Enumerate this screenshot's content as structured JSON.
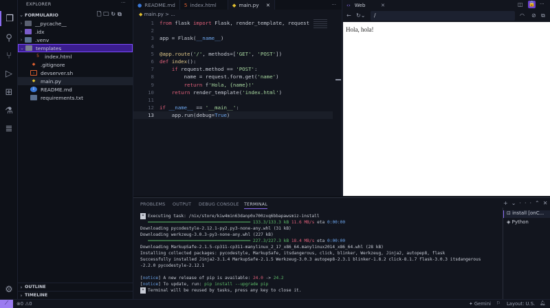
{
  "activity_bar": {
    "icons": [
      "files-icon",
      "search-icon",
      "source-control-icon",
      "run-debug-icon",
      "extensions-icon",
      "testing-icon",
      "list-icon"
    ],
    "settings": "gear-icon"
  },
  "sidebar": {
    "title": "EXPLORER",
    "project": "FORMULARIO",
    "items": [
      {
        "label": "__pycache__",
        "type": "folder",
        "expanded": false
      },
      {
        "label": ".idx",
        "type": "folder",
        "expanded": false
      },
      {
        "label": ".venv",
        "type": "folder",
        "expanded": false
      },
      {
        "label": "templates",
        "type": "folder",
        "expanded": true,
        "selected": true
      },
      {
        "label": "index.html",
        "type": "html"
      },
      {
        "label": ".gitignore",
        "type": "git"
      },
      {
        "label": "devserver.sh",
        "type": "shell"
      },
      {
        "label": "main.py",
        "type": "python",
        "active": true
      },
      {
        "label": "README.md",
        "type": "info"
      },
      {
        "label": "requirements.txt",
        "type": "text"
      }
    ],
    "outline": "OUTLINE",
    "timeline": "TIMELINE"
  },
  "editor": {
    "tabs": [
      {
        "label": "README.md"
      },
      {
        "label": "index.html"
      },
      {
        "label": "main.py",
        "active": true
      }
    ],
    "breadcrumb": "main.py > ...",
    "current_line": 13,
    "lines": [
      "from flask import Flask, render_template, request",
      "",
      "app = Flask(__name__)",
      "",
      "@app.route('/', methods=['GET', 'POST'])",
      "def index():",
      "    if request.method == 'POST':",
      "        name = request.form.get('name')",
      "        return f'Hola, {name}!'",
      "    return render_template('index.html')",
      "",
      "if __name__ == '__main__':",
      "    app.run(debug=True)"
    ]
  },
  "web": {
    "tab": "Web",
    "url": "/",
    "content": "Hola, hola!"
  },
  "panel": {
    "tabs": [
      "PROBLEMS",
      "OUTPUT",
      "DEBUG CONSOLE",
      "TERMINAL"
    ],
    "active_tab": "TERMINAL",
    "terminal": {
      "task": "Executing task: /nix/store/kiw4min63danp0x700zxq6bbapawsmiz-install",
      "p1": {
        "size": "133.3/133.3 kB",
        "speed": "11.6 MB/s",
        "eta_label": "eta",
        "eta": "0:00:00"
      },
      "l2": "Downloading pycodestyle-2.12.1-py2.py3-none-any.whl (31 kB)",
      "l3": "Downloading werkzeug-3.0.3-py3-none-any.whl (227 kB)",
      "p2": {
        "size": "227.3/227.3 kB",
        "speed": "18.4 MB/s",
        "eta_label": "eta",
        "eta": "0:00:00"
      },
      "l5": "Downloading MarkupSafe-2.1.5-cp311-cp311-manylinux_2_17_x86_64.manylinux2014_x86_64.whl (28 kB)",
      "l6": "Installing collected packages: pycodestyle, MarkupSafe, itsdangerous, click, blinker, Werkzeug, Jinja2, autopep8, flask",
      "l7": "Successfully installed Jinja2-3.1.4 MarkupSafe-2.1.5 Werkzeug-3.0.3 autopep8-2.3.1 blinker-1.8.2 click-8.1.7 flask-3.0.3 itsdangerous",
      "l8": "-2.2.0 pycodestyle-2.12.1",
      "n1": {
        "tag": "notice",
        "text": " A new release of pip is available: ",
        "old": "24.0",
        "arrow": " -> ",
        "new": "24.2"
      },
      "n2": {
        "tag": "notice",
        "text": " To update, run: ",
        "cmd": "pip install --upgrade pip"
      },
      "end": "Terminal will be reused by tasks, press any key to close it."
    },
    "terminals": [
      "install [onC...",
      "Python"
    ]
  },
  "status": {
    "errors": "0",
    "warnings": "0",
    "gemini": "Gemini",
    "layout": "Layout: U.S."
  }
}
